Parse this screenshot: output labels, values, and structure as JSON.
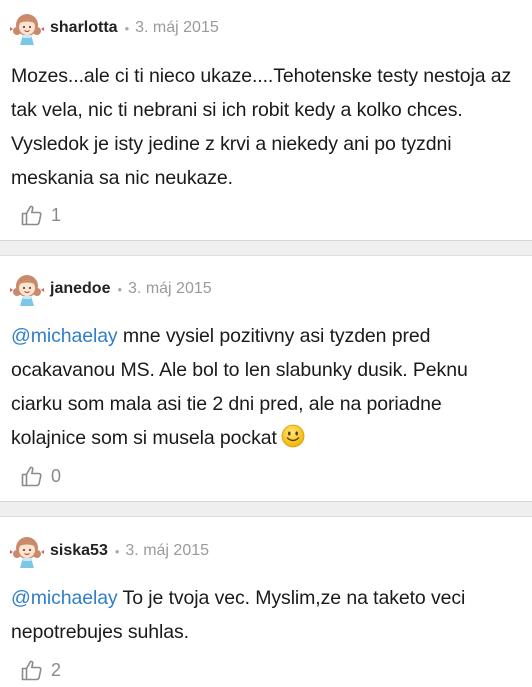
{
  "comments": [
    {
      "username": "sharlotta",
      "separator": "•",
      "date": "3. máj 2015",
      "mention": "",
      "text": "Mozes...ale ci ti nieco ukaze....Tehotenske testy nestoja az tak vela, nic ti nebrani si ich robit kedy a kolko chces. Vysledok je isty jedine z krvi a niekedy ani po tyzdni meskania sa nic neukaze.",
      "likes": "1"
    },
    {
      "username": "janedoe",
      "separator": "•",
      "date": "3. máj 2015",
      "mention": "@michaelay",
      "text": " mne vysiel pozitivny asi tyzden pred ocakavanou MS. Ale bol to len slabunky dusik. Peknu ciarku som mala asi tie 2 dni pred, ale na poriadne kolajnice som si musela pockat",
      "likes": "0"
    },
    {
      "username": "siska53",
      "separator": "•",
      "date": "3. máj 2015",
      "mention": "@michaelay",
      "text": " To je tvoja vec. Myslim,ze na taketo veci nepotrebujes suhlas.",
      "likes": "2"
    }
  ],
  "colors": {
    "mention": "#2f7fc8",
    "separator_band": "#efefef",
    "meta_gray": "#9a9a9a"
  },
  "icons": {
    "avatar": "girl-avatar-icon",
    "like": "thumbs-up-icon",
    "emoji": "smiley-emoji-icon"
  }
}
